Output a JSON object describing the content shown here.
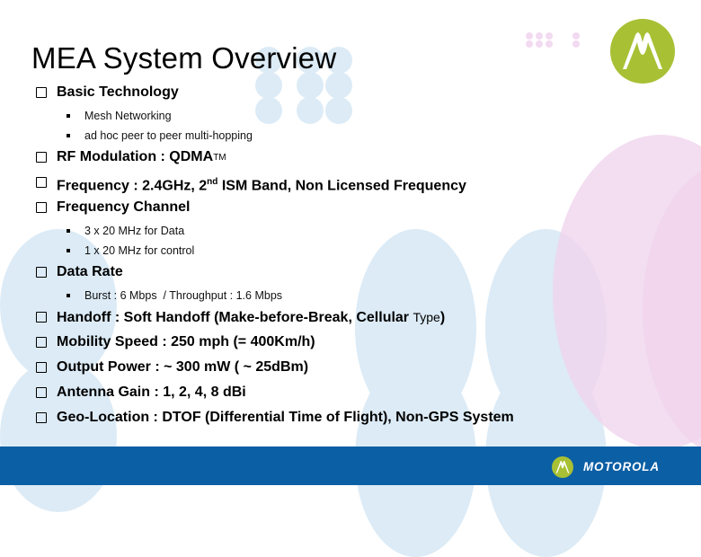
{
  "slide": {
    "title": "MEA System Overview",
    "brand": "MOTOROLA",
    "colors": {
      "accent_green": "#a8c034",
      "footer_blue": "#0b5fa4",
      "deco_blue": "#dcebf6",
      "deco_pink": "#f0d4ee"
    }
  },
  "items": [
    {
      "label": "Basic Technology",
      "sub": [
        "Mesh Networking",
        "ad hoc peer to peer multi-hopping"
      ]
    },
    {
      "label": "RF Modulation : QDMA",
      "tm": "TM"
    },
    {
      "label_pre": "Frequency : 2.4GHz, 2",
      "sup": "nd",
      "label_post": " ISM Band, Non Licensed Frequency"
    },
    {
      "label": "Frequency Channel",
      "sub": [
        "3 x 20 MHz for Data",
        "1 x 20 MHz for control"
      ]
    },
    {
      "label": "Data Rate",
      "sub": [
        "Burst : 6 Mbps  / Throughput : 1.6 Mbps"
      ]
    },
    {
      "label": "Handoff : Soft Handoff (Make-before-Break, Cellular ",
      "small": "Type",
      "tail": ")"
    },
    {
      "label": "Mobility Speed : 250 mph (= 400Km/h)"
    },
    {
      "label": "Output Power : ~ 300 mW ( ~ 25dBm)"
    },
    {
      "label": "Antenna Gain : 1, 2, 4, 8 dBi"
    },
    {
      "label": "Geo-Location : DTOF (Differential Time of Flight), Non-GPS System"
    }
  ]
}
